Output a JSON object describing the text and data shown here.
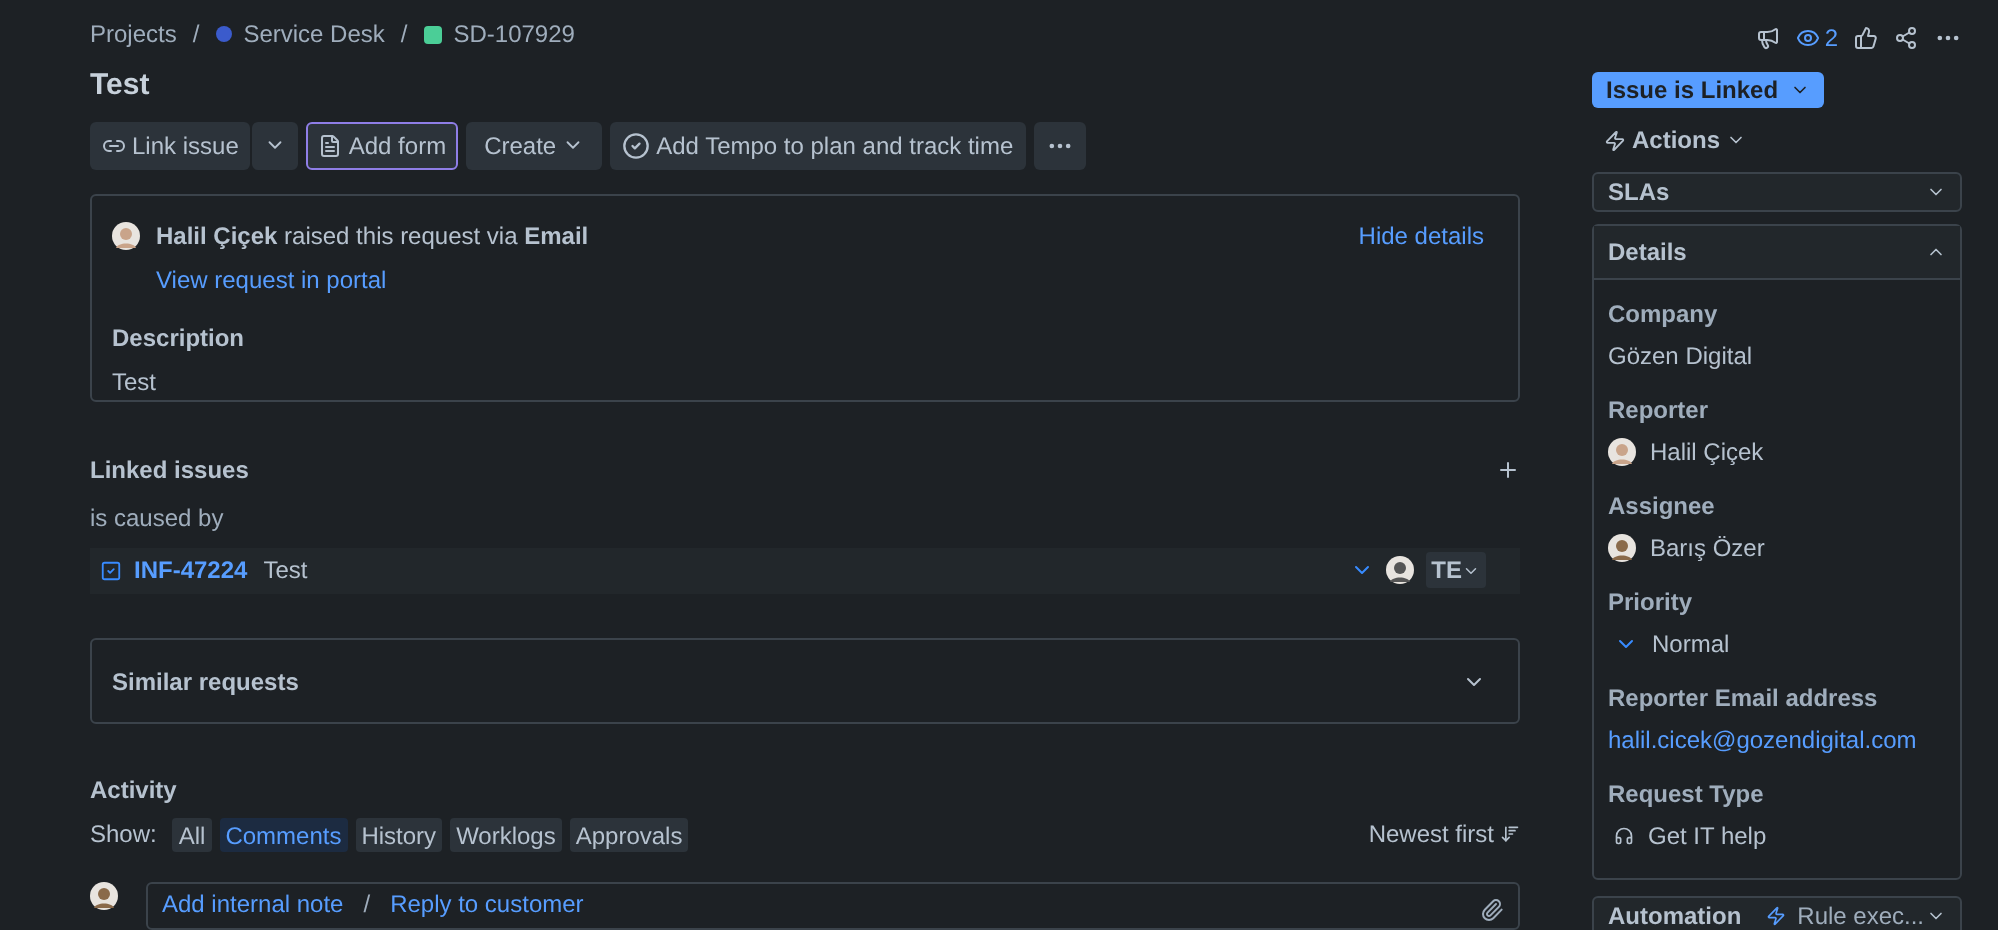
{
  "breadcrumbs": [
    {
      "label": "Projects",
      "kind": "text"
    },
    {
      "label": "/",
      "kind": "separator"
    },
    {
      "label": "Service Desk",
      "kind": "project"
    },
    {
      "label": "/",
      "kind": "separator"
    },
    {
      "label": "SD-107929",
      "kind": "issue"
    }
  ],
  "title": "Test",
  "toolbar": [
    {
      "label": "Link issue",
      "kind": "link"
    },
    {
      "kind": "split"
    },
    {
      "label": "Add form",
      "kind": "form",
      "selected": true
    },
    {
      "label": "Create",
      "kind": "menu"
    },
    {
      "label": "Add Tempo to plan and track time",
      "kind": "tempo"
    },
    {
      "kind": "more"
    }
  ],
  "request": {
    "text": "**Halil Çiçek** raised this request via **Email**",
    "portal_link": "View request in portal",
    "hide_link": "Hide details",
    "description_label": "Description",
    "description": "Test"
  },
  "linked": {
    "title": "Linked issues",
    "relation": "is caused by",
    "items": [
      {
        "key": "INF-47224",
        "summary": "Test",
        "status": "TE"
      }
    ]
  },
  "similar": {
    "title": "Similar requests",
    "expanded": false
  },
  "activity": {
    "title": "Activity",
    "show_label": "Show:",
    "filters": [
      {
        "label": "All",
        "selected": false
      },
      {
        "label": "Comments",
        "selected": true
      },
      {
        "label": "History",
        "selected": false
      },
      {
        "label": "Worklogs",
        "selected": false
      },
      {
        "label": "Approvals",
        "selected": false
      }
    ],
    "sort": "Newest first",
    "comment_actions": [
      "Add internal note",
      "Reply to customer"
    ],
    "comment_separator": "/"
  },
  "header_actions": {
    "watchers": "2"
  },
  "status": "Issue is Linked",
  "actions": "Actions",
  "panels": [
    {
      "title": "SLAs",
      "expanded": false
    }
  ],
  "details": {
    "title": "Details",
    "expanded": true,
    "fields": [
      {
        "label": "Company",
        "value": "Gözen Digital",
        "kind": "text"
      },
      {
        "label": "Reporter",
        "value": "Halil Çiçek",
        "kind": "user"
      },
      {
        "label": "Assignee",
        "value": "Barış Özer",
        "kind": "user"
      },
      {
        "label": "Priority",
        "value": "Normal",
        "kind": "priority"
      },
      {
        "label": "Reporter Email address",
        "value": "halil.cicek@gozendigital.com",
        "kind": "link"
      },
      {
        "label": "Request Type",
        "value": "Get IT help",
        "kind": "request"
      }
    ]
  },
  "automation": {
    "title": "Automation",
    "value": "Rule exec..."
  }
}
